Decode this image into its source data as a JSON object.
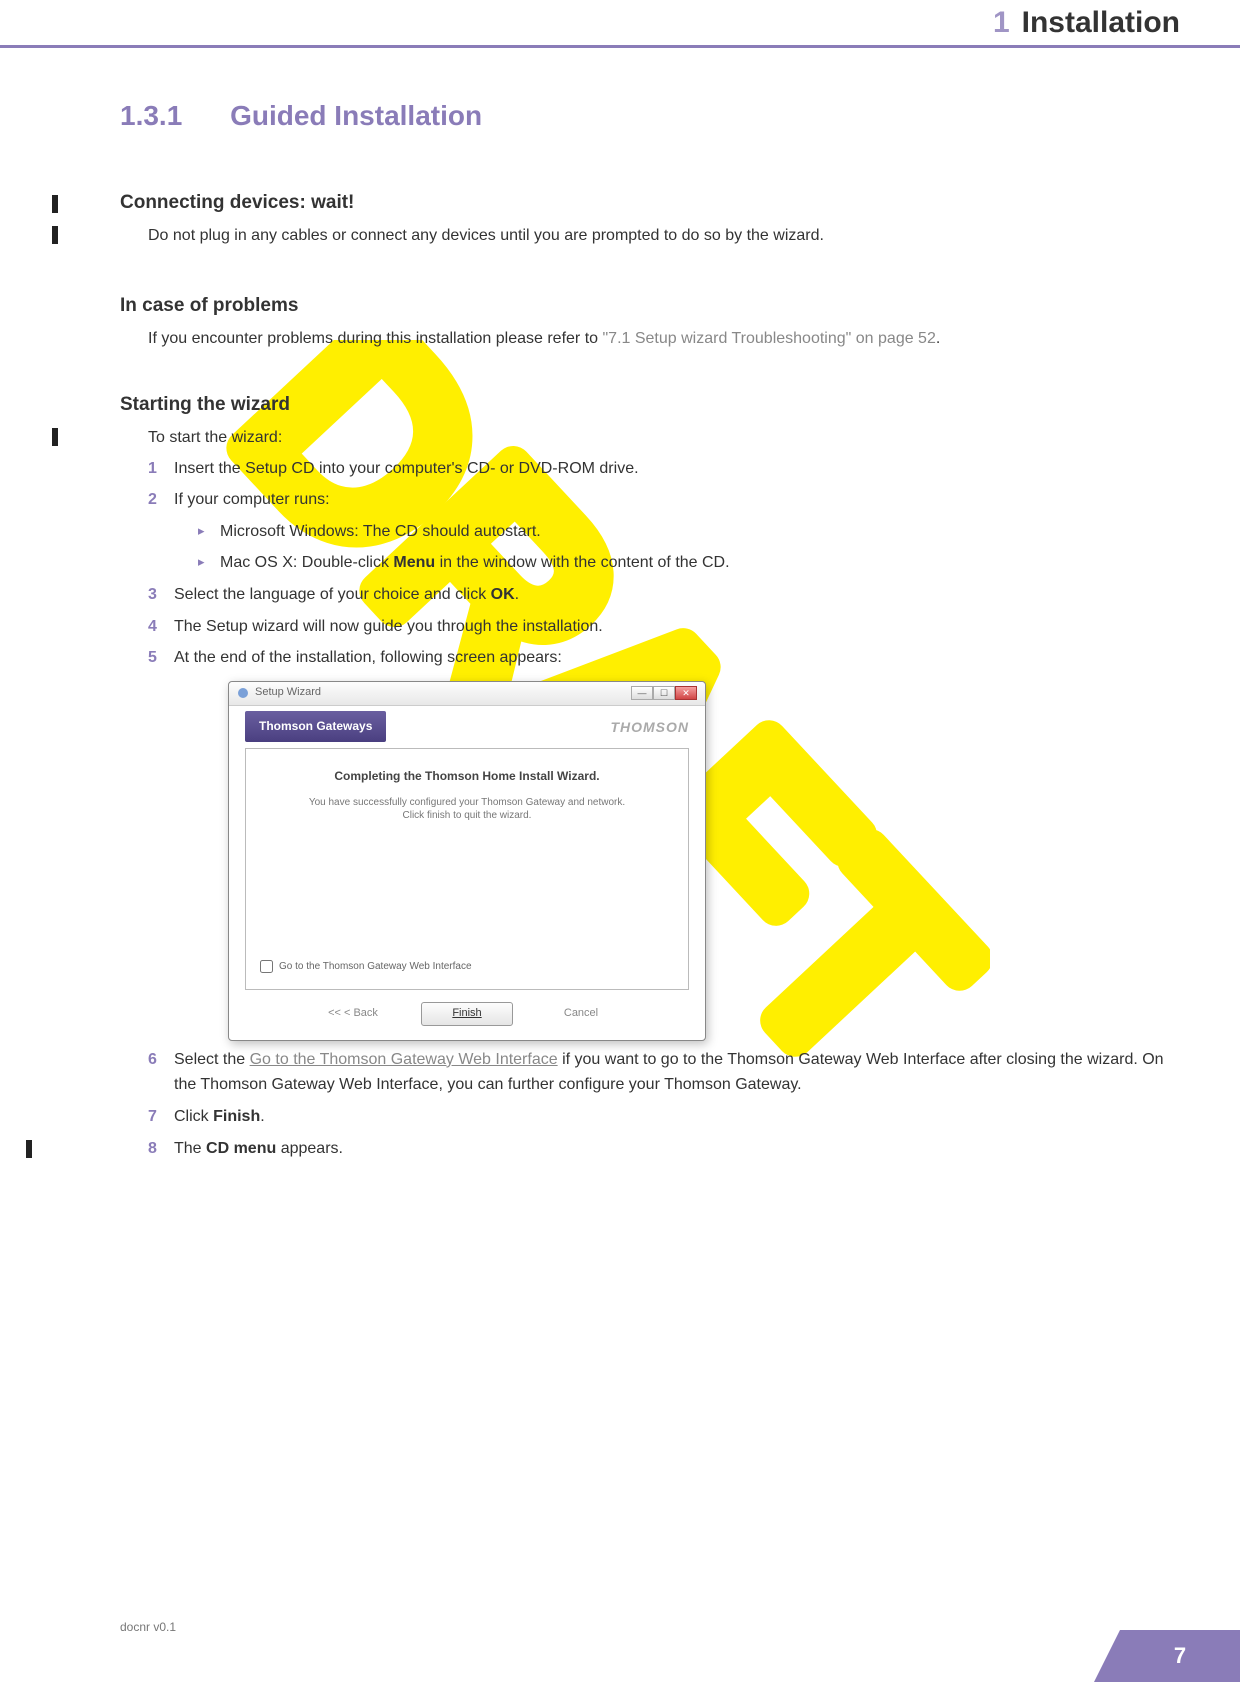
{
  "header": {
    "chapter_num": "1",
    "chapter_title": "Installation"
  },
  "section": {
    "number": "1.3.1",
    "title": "Guided Installation"
  },
  "connecting": {
    "heading": "Connecting devices: wait!",
    "text": "Do not plug in any cables or connect any devices until you are prompted to do so by the wizard."
  },
  "problems": {
    "heading": "In case of problems",
    "text_prefix": "If you encounter problems during this installation please refer to ",
    "ref": "\"7.1 Setup wizard Troubleshooting\" on page 52",
    "text_suffix": "."
  },
  "starting": {
    "heading": "Starting the wizard",
    "intro": "To start the wizard:",
    "steps": {
      "s1": "Insert the Setup CD into your computer's CD- or DVD-ROM drive.",
      "s2": "If your computer runs:",
      "s2a": "Microsoft Windows: The CD should autostart.",
      "s2b_pre": "Mac OS X: Double-click ",
      "s2b_bold": "Menu",
      "s2b_post": " in the window with the content of the CD.",
      "s3_pre": "Select the language of your choice and click ",
      "s3_bold": "OK",
      "s3_post": ".",
      "s4": "The Setup wizard will now guide you through the installation.",
      "s5": "At the end of the installation, following screen appears:",
      "s6_pre": "Select the ",
      "s6_link": "Go to the Thomson Gateway Web Interface",
      "s6_mid1": " if you want to go to the ",
      "s6_grey1": "Thomson Gateway Web Interface",
      "s6_mid2": " after closing the wizard. On the ",
      "s6_grey2": "Thomson Gateway Web Interface",
      "s6_post": ", you can further configure your Thomson Gateway.",
      "s7_pre": "Click ",
      "s7_bold": "Finish",
      "s7_post": ".",
      "s8_pre": "The ",
      "s8_bold": "CD menu",
      "s8_post": " appears."
    }
  },
  "wizard": {
    "window_title": "Setup Wizard",
    "pill": "Thomson Gateways",
    "logo": "THOMSON",
    "main": "Completing the Thomson Home Install Wizard.",
    "sub1": "You have successfully configured your Thomson Gateway and network.",
    "sub2": "Click finish to quit the wizard.",
    "checkbox": "Go to the Thomson Gateway Web Interface",
    "btn_back": "<<   < Back",
    "btn_finish": "Finish",
    "btn_cancel": "Cancel"
  },
  "footer": {
    "docver": "docnr v0.1",
    "pagenum": "7"
  },
  "nums": {
    "n1": "1",
    "n2": "2",
    "n3": "3",
    "n4": "4",
    "n5": "5",
    "n6": "6",
    "n7": "7",
    "n8": "8"
  }
}
